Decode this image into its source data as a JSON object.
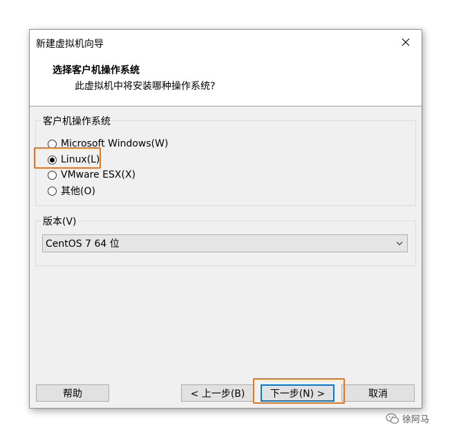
{
  "window": {
    "title": "新建虚拟机向导"
  },
  "header": {
    "title": "选择客户机操作系统",
    "subtitle": "此虚拟机中将安装哪种操作系统?"
  },
  "os_group": {
    "label": "客户机操作系统",
    "options": [
      {
        "label": "Microsoft Windows(W)",
        "selected": false
      },
      {
        "label": "Linux(L)",
        "selected": true
      },
      {
        "label": "VMware ESX(X)",
        "selected": false
      },
      {
        "label": "其他(O)",
        "selected": false
      }
    ]
  },
  "version_group": {
    "label": "版本(V)",
    "selected": "CentOS 7 64 位"
  },
  "buttons": {
    "help": "帮助",
    "back": "< 上一步(B)",
    "next": "下一步(N) >",
    "cancel": "取消"
  },
  "watermark": {
    "text": "徐阿马"
  },
  "colors": {
    "highlight": "#e8751a",
    "default_button_border": "#0078d7",
    "dialog_bg": "#f0f0f0"
  },
  "icons": {
    "close": "close-icon",
    "dropdown": "chevron-down-icon",
    "watermark": "wechat-icon"
  }
}
